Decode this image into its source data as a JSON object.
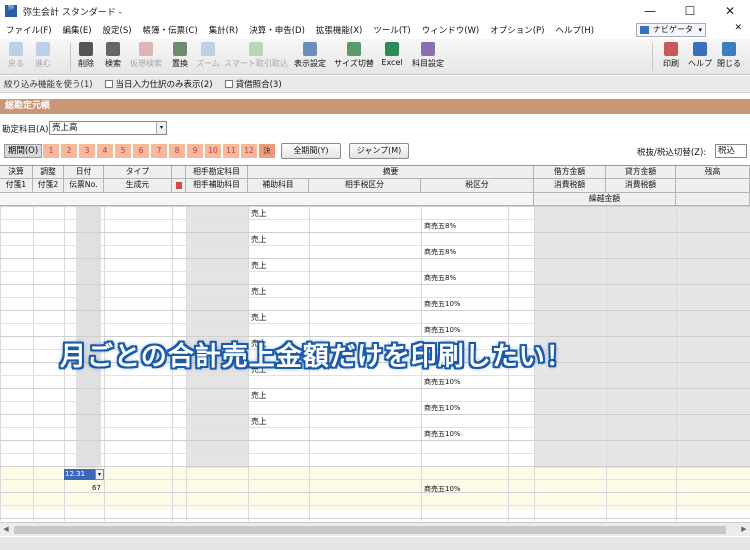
{
  "window": {
    "app_icon": "弥",
    "title": "弥生会計 スタンダード -",
    "minimize": "—",
    "maximize": "☐",
    "close": "✕"
  },
  "menu": [
    "ファイル(F)",
    "編集(E)",
    "設定(S)",
    "帳簿・伝票(C)",
    "集計(R)",
    "決算・申告(D)",
    "拡張機能(X)",
    "ツール(T)",
    "ウィンドウ(W)",
    "オプション(P)",
    "ヘルプ(H)"
  ],
  "navigator": {
    "label": "ナビゲータ",
    "dropdown": "▾"
  },
  "mdi_close": "✕",
  "toolbar": {
    "items": [
      {
        "label": "戻る",
        "icon": "back-arrow-icon",
        "enabled": false,
        "color": "#7aa7e0"
      },
      {
        "label": "進む",
        "icon": "forward-arrow-icon",
        "enabled": false,
        "color": "#7aa7e0"
      },
      {
        "label": "削除",
        "icon": "trash-icon",
        "enabled": true,
        "color": "#555555"
      },
      {
        "label": "検索",
        "icon": "magnifier-icon",
        "enabled": true,
        "color": "#666666"
      },
      {
        "label": "仮想検索",
        "icon": "virtual-search-icon",
        "enabled": false,
        "color": "#c46a6a"
      },
      {
        "label": "置換",
        "icon": "replace-icon",
        "enabled": true,
        "color": "#6d8c6d"
      },
      {
        "label": "ズーム",
        "icon": "zoom-icon",
        "enabled": false,
        "color": "#8aa8c8"
      },
      {
        "label": "スマート取引取込",
        "icon": "smart-import-icon",
        "enabled": false,
        "color": "#7ab07a"
      },
      {
        "label": "表示設定",
        "icon": "display-settings-icon",
        "enabled": true,
        "color": "#6b8fb8"
      },
      {
        "label": "サイズ切替",
        "icon": "size-toggle-icon",
        "enabled": true,
        "color": "#5a9a6a"
      },
      {
        "label": "Excel",
        "icon": "excel-icon",
        "enabled": true,
        "color": "#2e8b57"
      },
      {
        "label": "科目設定",
        "icon": "account-settings-icon",
        "enabled": true,
        "color": "#8a6fb0"
      },
      {
        "label": "印刷",
        "icon": "printer-icon",
        "enabled": true,
        "color": "#c85a5a"
      },
      {
        "label": "ヘルプ",
        "icon": "help-icon",
        "enabled": true,
        "color": "#3a6fc0"
      },
      {
        "label": "閉じる",
        "icon": "close-door-icon",
        "enabled": true,
        "color": "#3a7fc0"
      }
    ]
  },
  "filter_bar": {
    "filter_link": "絞り込み機能を使う(1)",
    "today_only": "当日入力仕訳のみ表示(2)",
    "cross_check": "貸借照合(3)"
  },
  "section_title": "総勘定元帳",
  "account": {
    "label": "勘定科目(A):",
    "value": "売上高",
    "dropdown": "▾"
  },
  "period": {
    "label": "期間(O)",
    "months": [
      "1",
      "2",
      "3",
      "4",
      "5",
      "6",
      "7",
      "8",
      "9",
      "10",
      "11",
      "12",
      "決"
    ],
    "all_period_button": "全期間(Y)",
    "jump_button": "ジャンプ(M)",
    "tax_toggle_label": "税抜/税込切替(Z):",
    "tax_toggle_value": "税込"
  },
  "grid": {
    "headers_row1": [
      "決算",
      "調整",
      "日付",
      "タイプ",
      "相手勘定科目",
      "摘要",
      "借方金額",
      "貸方金額",
      "残高"
    ],
    "headers_row2": [
      "付箋1",
      "付箋2",
      "伝票No.",
      "生成元",
      "相手補助科目",
      "補助科目",
      "相手税区分",
      "税区分",
      "消費税額",
      "消費税額"
    ],
    "headers_row3": [
      "繰越金額"
    ],
    "rows": [
      {
        "summary": "売上",
        "tax": "商売五8%"
      },
      {
        "summary": "売上",
        "tax": "商売五8%"
      },
      {
        "summary": "売上",
        "tax": "商売五8%"
      },
      {
        "summary": "売上",
        "tax": "商売五10%"
      },
      {
        "summary": "売上",
        "tax": "商売五10%"
      },
      {
        "summary": "売上",
        "tax": "商売五10%"
      },
      {
        "summary": "売上",
        "tax": "商売五10%"
      },
      {
        "summary": "売上",
        "tax": "商売五10%"
      },
      {
        "summary": "売上",
        "tax": "商売五10%"
      }
    ],
    "input_row": {
      "date": "12.31",
      "dropdown": "▾",
      "slip_no": "67",
      "tax": "商売五10%"
    }
  },
  "overlay_caption": "月ごとの合計売上金額だけを印刷したい！",
  "scrollbar": {
    "left_arrow": "◀",
    "right_arrow": "▶"
  }
}
